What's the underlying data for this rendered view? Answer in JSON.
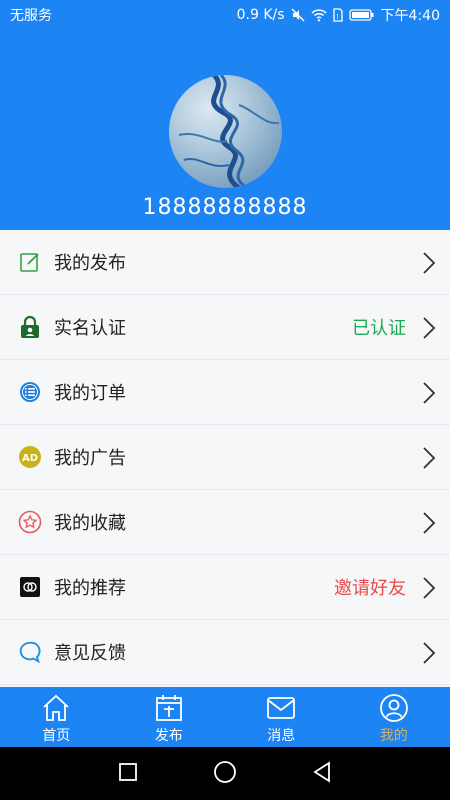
{
  "status_bar": {
    "carrier": "无服务",
    "speed": "0.9 K/s",
    "time": "下午4:40"
  },
  "profile": {
    "phone": "18888888888"
  },
  "menu": [
    {
      "label": "我的发布",
      "status": "",
      "icon": "edit-icon"
    },
    {
      "label": "实名认证",
      "status": "已认证",
      "status_color": "#1aab4c",
      "icon": "lock-id-icon"
    },
    {
      "label": "我的订单",
      "status": "",
      "icon": "order-list-icon"
    },
    {
      "label": "我的广告",
      "status": "",
      "icon": "ad-icon"
    },
    {
      "label": "我的收藏",
      "status": "",
      "icon": "star-icon"
    },
    {
      "label": "我的推荐",
      "status": "邀请好友",
      "status_color": "#e84a4a",
      "icon": "recommend-icon"
    },
    {
      "label": "意见反馈",
      "status": "",
      "icon": "feedback-icon"
    }
  ],
  "tabs": [
    {
      "label": "首页",
      "icon": "home-icon",
      "active": false
    },
    {
      "label": "发布",
      "icon": "publish-icon",
      "active": false
    },
    {
      "label": "消息",
      "icon": "message-icon",
      "active": false
    },
    {
      "label": "我的",
      "icon": "profile-icon",
      "active": true
    }
  ],
  "colors": {
    "primary": "#1d84f3",
    "active_tab": "#d4b068"
  }
}
